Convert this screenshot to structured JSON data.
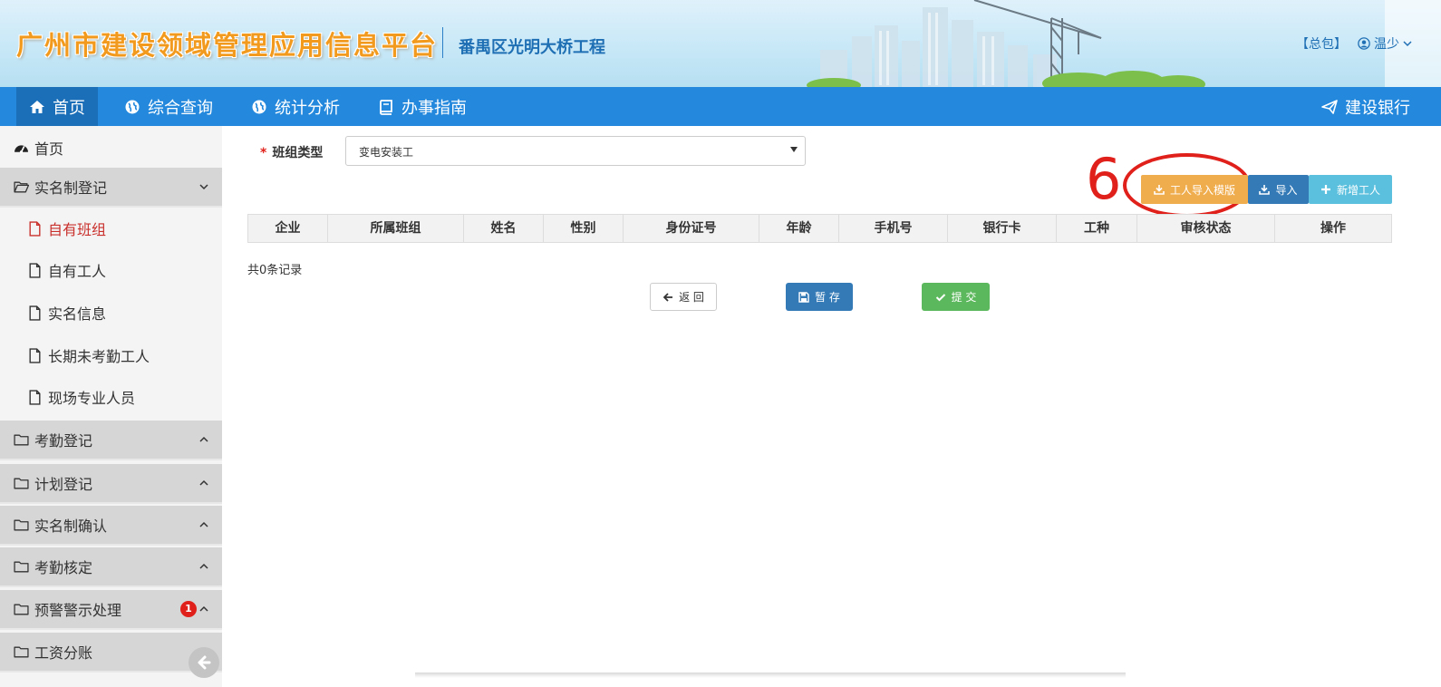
{
  "header": {
    "site_title": "广州市建设领域管理应用信息平台",
    "project_name": "番禺区光明大桥工程",
    "role_label": "【总包】",
    "user_name": "温少"
  },
  "nav": {
    "items": [
      {
        "label": "首页",
        "icon": "home-icon"
      },
      {
        "label": "综合查询",
        "icon": "globe-icon"
      },
      {
        "label": "统计分析",
        "icon": "globe-icon"
      },
      {
        "label": "办事指南",
        "icon": "book-icon"
      }
    ],
    "right_label": "建设银行"
  },
  "sidebar": {
    "home": "首页",
    "groups": [
      {
        "label": "实名制登记",
        "expanded": true,
        "items": [
          "自有班组",
          "自有工人",
          "实名信息",
          "长期未考勤工人",
          "现场专业人员"
        ]
      },
      {
        "label": "考勤登记"
      },
      {
        "label": "计划登记"
      },
      {
        "label": "实名制确认"
      },
      {
        "label": "考勤核定"
      },
      {
        "label": "预警警示处理",
        "badge": "1"
      },
      {
        "label": "工资分账"
      }
    ],
    "active_item": "自有班组"
  },
  "form": {
    "required_mark": "*",
    "team_type_label": "班组类型",
    "team_type_value": "变电安装工"
  },
  "annotation": {
    "step_number": "6"
  },
  "toolbar": {
    "template_label": "工人导入模版",
    "import_label": "导入",
    "add_label": "新增工人"
  },
  "table": {
    "columns": [
      "企业",
      "所属班组",
      "姓名",
      "性别",
      "身份证号",
      "年龄",
      "手机号",
      "银行卡",
      "工种",
      "审核状态",
      "操作"
    ],
    "rows": []
  },
  "record_count": "共0条记录",
  "actions": {
    "back_label": "返 回",
    "save_label": "暂 存",
    "submit_label": "提 交"
  },
  "colors": {
    "nav_bg": "#2489dd",
    "title_orange": "#f29a1e",
    "warning_btn": "#f0ad4e",
    "primary_btn": "#337ab7",
    "info_btn": "#5bc0de",
    "success_btn": "#5cb85c",
    "annotation_red": "#e0201a"
  }
}
